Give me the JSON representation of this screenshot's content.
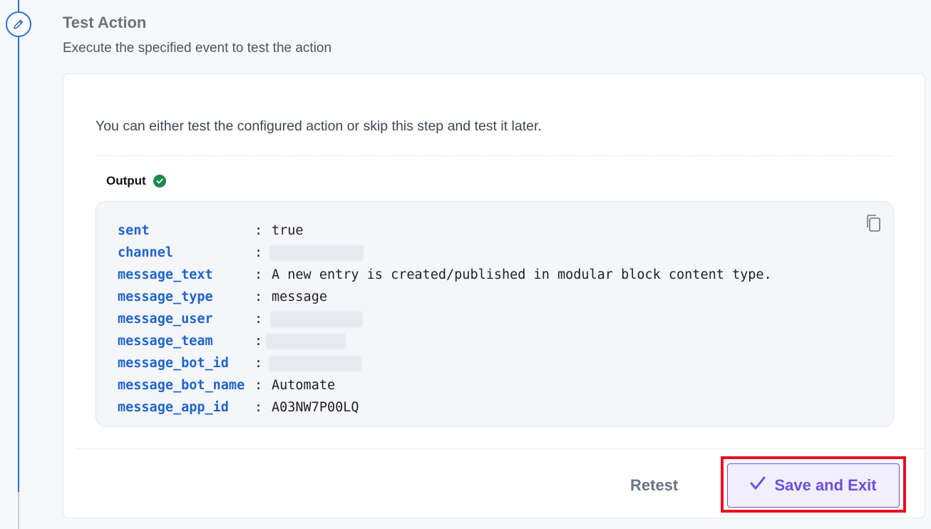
{
  "step": {
    "title": "Test Action",
    "subtitle": "Execute the specified event to test the action",
    "icon": "pencil-icon"
  },
  "card": {
    "intro": "You can either test the configured action or skip this step and test it later.",
    "output_label": "Output",
    "output_status_icon": "check-circle-icon",
    "copy_icon": "copy-icon",
    "separator": ":",
    "fields": [
      {
        "key": "sent",
        "value": "true"
      },
      {
        "key": "channel",
        "value": ""
      },
      {
        "key": "message_text",
        "value": "A new entry is created/published in modular block content type."
      },
      {
        "key": "message_type",
        "value": "message"
      },
      {
        "key": "message_user",
        "value": ""
      },
      {
        "key": "message_team",
        "value": ""
      },
      {
        "key": "message_bot_id",
        "value": ""
      },
      {
        "key": "message_bot_name",
        "value": "Automate"
      },
      {
        "key": "message_app_id",
        "value": "A03NW7P00LQ"
      }
    ]
  },
  "actions": {
    "retest_label": "Retest",
    "save_label": "Save and Exit",
    "save_icon": "checkmark-icon"
  },
  "colors": {
    "accent": "#6c4ee0",
    "key_blue": "#1f65cc",
    "success_green": "#1b8a4f",
    "highlight_red": "#e8101f",
    "rail_blue": "#2c6fd1"
  }
}
